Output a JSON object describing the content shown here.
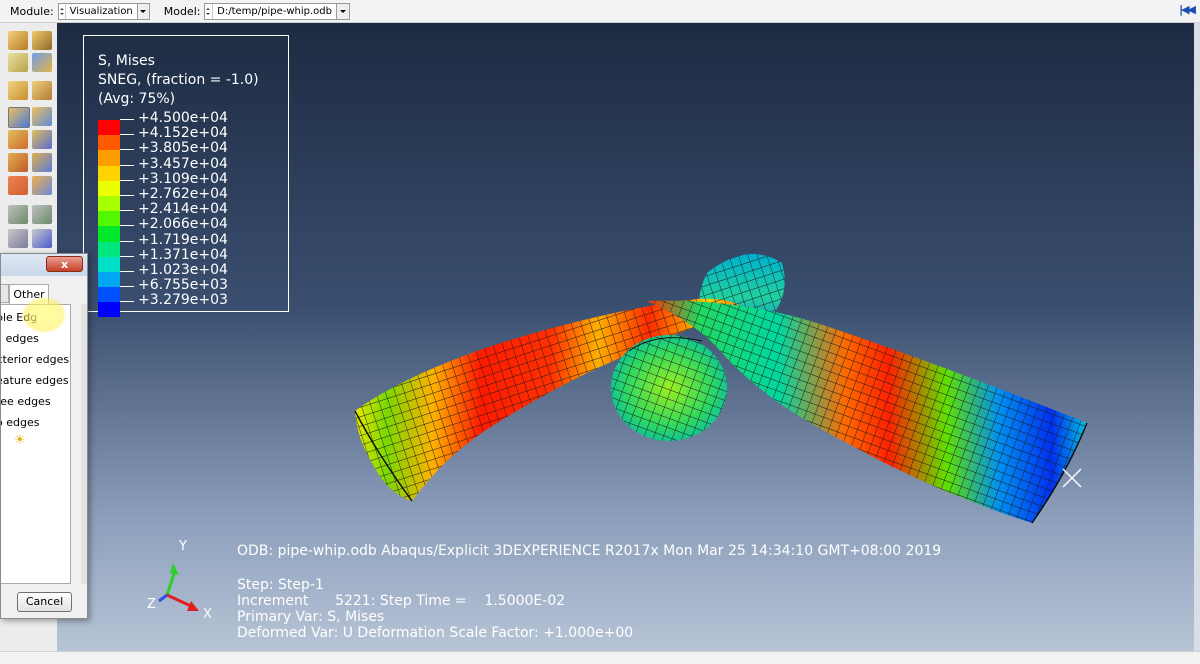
{
  "topbar": {
    "module_label": "Module:",
    "module_value": "Visualization",
    "model_label": "Model:",
    "model_value": "D:/temp/pipe-whip.odb",
    "right_icon": "first-frame-icon"
  },
  "legend": {
    "title1": "S, Mises",
    "title2": "SNEG, (fraction = -1.0)",
    "title3": "(Avg: 75%)",
    "levels": [
      "+4.500e+04",
      "+4.152e+04",
      "+3.805e+04",
      "+3.457e+04",
      "+3.109e+04",
      "+2.762e+04",
      "+2.414e+04",
      "+2.066e+04",
      "+1.719e+04",
      "+1.371e+04",
      "+1.023e+04",
      "+6.755e+03",
      "+3.279e+03"
    ],
    "colors": [
      "#ff0000",
      "#ff5a00",
      "#ff9e00",
      "#ffd400",
      "#eaff00",
      "#a8ff00",
      "#52f700",
      "#00e82a",
      "#00e87d",
      "#00e0c8",
      "#00a6f2",
      "#0050ff",
      "#0000ff"
    ]
  },
  "info": {
    "odb_line": "ODB: pipe-whip.odb    Abaqus/Explicit 3DEXPERIENCE R2017x    Mon Mar 25 14:34:10 GMT+08:00 2019",
    "step": "Step: Step-1",
    "increment": "Increment      5221: Step Time =    1.5000E-02",
    "primary": "Primary Var: S, Mises",
    "deformed": "Deformed Var: U   Deformation Scale Factor: +1.000e+00"
  },
  "triad": {
    "x": "X",
    "y": "Y",
    "z": "Z"
  },
  "dialog": {
    "close": "x",
    "tab": "Other",
    "options": [
      "ble Edg",
      "ll edges",
      "xterior edges",
      "eature edges",
      "ree edges",
      "o edges"
    ],
    "cancel": "Cancel"
  }
}
